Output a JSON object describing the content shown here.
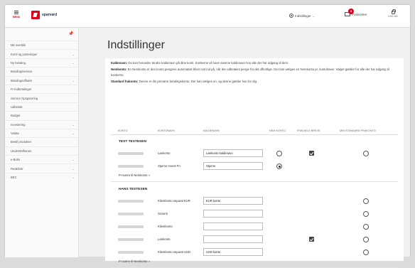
{
  "topbar": {
    "menu_label": "MENU",
    "logo_text": "sparvard",
    "settings_label": "Indstillinger",
    "messages_label": "Postcenter",
    "messages_count": "8",
    "logout_label": "LOG UD",
    "chevron": "⌄"
  },
  "sidebar": {
    "items": [
      {
        "label": "Mit overblik",
        "chevron": ""
      },
      {
        "label": "Konti og posteringer",
        "chevron": "⌄"
      },
      {
        "label": "Ny betaling",
        "chevron": "⌄"
      },
      {
        "label": "Betalingsservice",
        "chevron": ""
      },
      {
        "label": "Betalingsoffader",
        "chevron": "⌄"
      },
      {
        "label": "Fr-indbetalinger",
        "chevron": ""
      },
      {
        "label": "Service Opsparering",
        "chevron": ""
      },
      {
        "label": "Udbetale",
        "chevron": ""
      },
      {
        "label": "Budget",
        "chevron": ""
      },
      {
        "label": "Investering",
        "chevron": "⌄"
      },
      {
        "label": "Valuta",
        "chevron": "⌄"
      },
      {
        "label": "Bestil produkter",
        "chevron": ""
      },
      {
        "label": "Underskriftsrum",
        "chevron": ""
      },
      {
        "label": "e-Boks",
        "chevron": "⌄"
      },
      {
        "label": "Reaktivér",
        "chevron": "⌄"
      },
      {
        "label": "BEC",
        "chevron": "⌄"
      }
    ]
  },
  "main": {
    "title": "Indstillinger",
    "info": {
      "kaldenavn_label": "Kaldenavn:",
      "kaldenavn_text": " Du kan herunder ændre kaldenavn på dine konti. Kontierne vil have samme kaldenavn hos alle der har adgang til dem.",
      "nemkonto_label": "Nemkonto:",
      "nemkonto_text": " En Nemkonto er den konto pengene automatisk bliver sat ind på, når der udbetales penge fra det offentlige. Der kan vælges en Nemkonto pr. kontohaver. Valget gælder for alle der har adgang til kontierne.",
      "standard_label": "Standard frakonto:",
      "standard_text": " Denne er din primære betalingskonto. Der kan vælges en, og denne gælder kun for dig."
    },
    "headers": {
      "konto": "KONTO",
      "kontonavn": "KONTONAVN",
      "kaldenavn": "KALDENAVN",
      "nem": "NEM KONTO",
      "fravaelg": "FRAVÆLG BREVE",
      "standard": "MIN STANDARD FRAKONTO"
    },
    "groups": [
      {
        "name": "TEST TESTESEN",
        "link": "P-numre til Nemkonto »",
        "rows": [
          {
            "type": "Lønkonto",
            "nickname": "Lønkonto kaldenavn",
            "has_input": true,
            "nem": "off",
            "breve": true,
            "standard": "off"
          },
          {
            "type": "Stjerne Invest Fri",
            "nickname": "Stjerne",
            "has_input": true,
            "nem": "on",
            "breve": false,
            "standard": "none"
          }
        ]
      },
      {
        "name": "HANS TESTESEN",
        "link": "P-numre til Nemkonto »",
        "rows": [
          {
            "type": "Klientkonto separat EUR",
            "nickname": "EUR konto",
            "has_input": true,
            "nem": "none",
            "breve": false,
            "standard": "off"
          },
          {
            "type": "Garanti",
            "nickname": "",
            "has_input": true,
            "nem": "none",
            "breve": false,
            "standard": "off"
          },
          {
            "type": "Klientkonto",
            "nickname": "",
            "has_input": true,
            "nem": "none",
            "breve": false,
            "standard": "off"
          },
          {
            "type": "Lønkonto",
            "nickname": "",
            "has_input": true,
            "nem": "none",
            "breve": true,
            "standard": "off"
          },
          {
            "type": "Klientkonto separat USD",
            "nickname": "USD konto",
            "has_input": true,
            "nem": "none",
            "breve": false,
            "standard": "off"
          }
        ]
      }
    ]
  }
}
